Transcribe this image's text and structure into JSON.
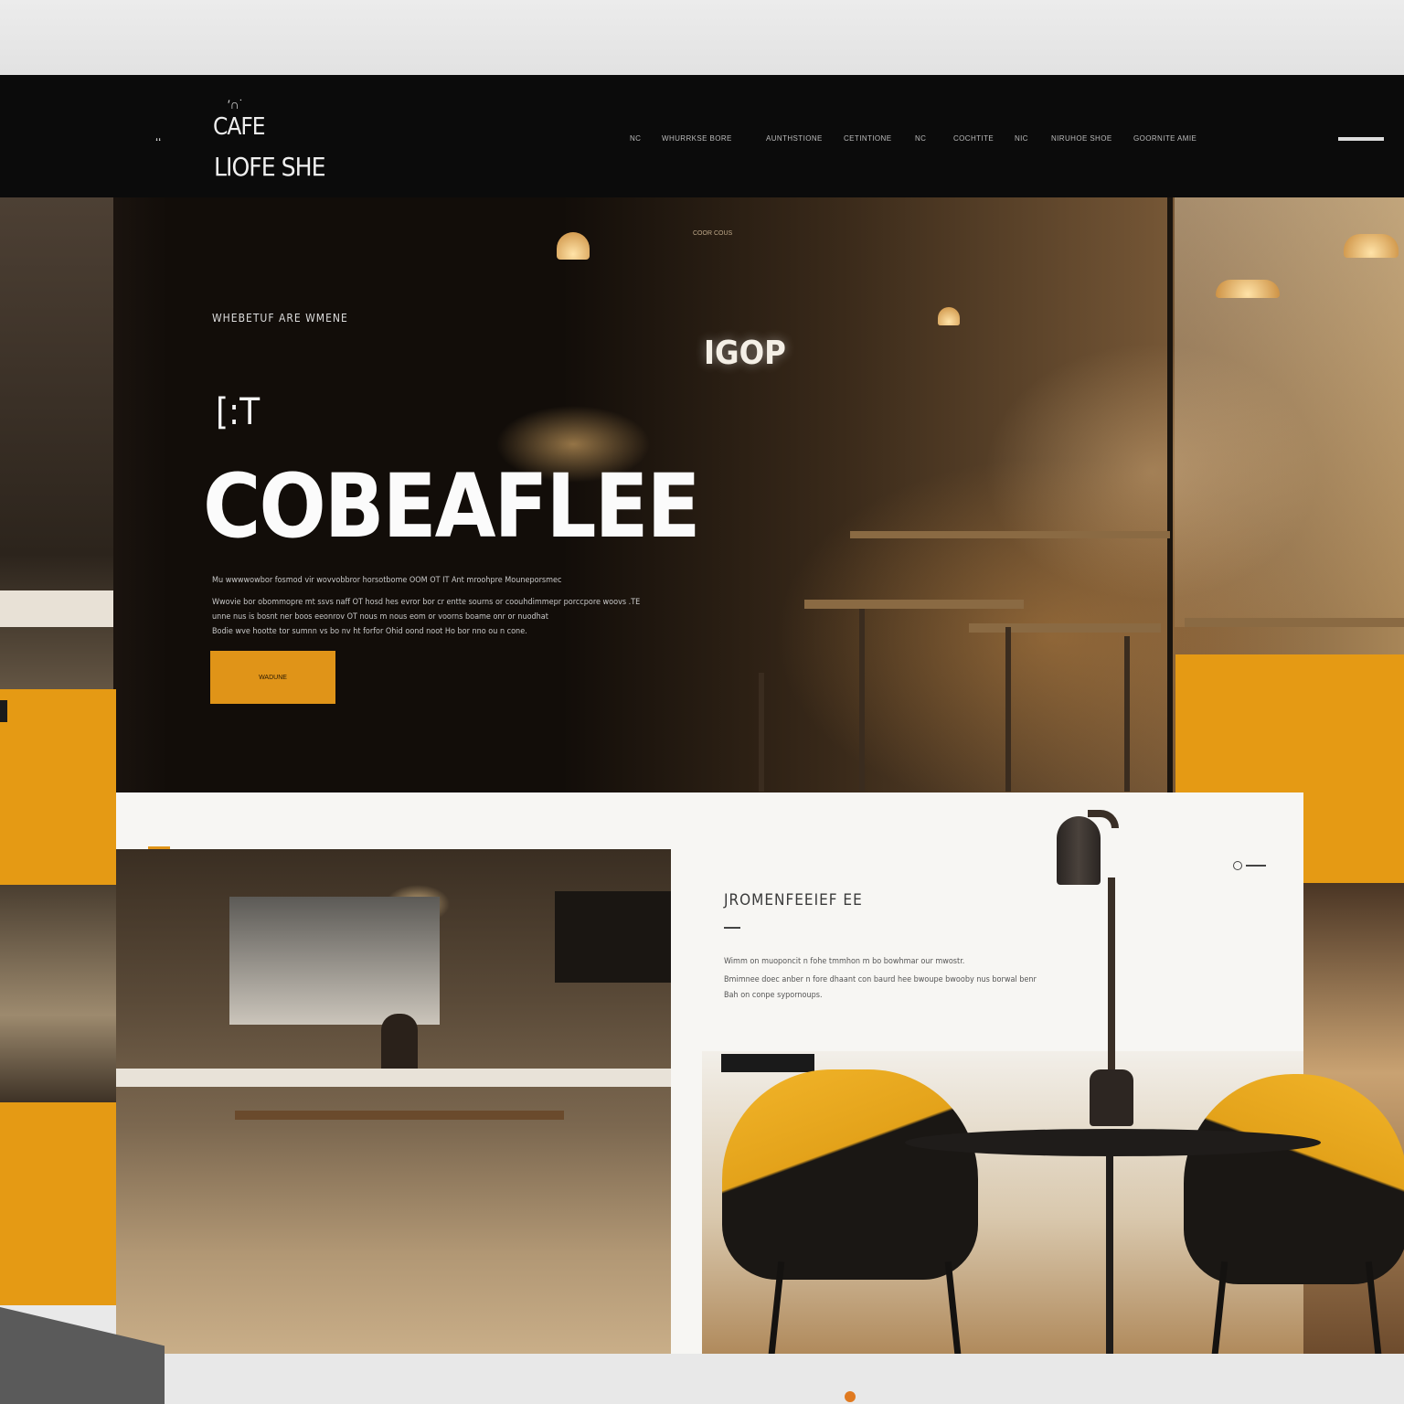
{
  "header": {
    "logo_mark": "ʻʻ",
    "logo_deco": "′∩˙",
    "logo_top": "CAFE",
    "logo_main": "LIOFE SHE",
    "nav": [
      "NC",
      "WHURRKSE BORE",
      "AUNTHSTIONE",
      "CETINTIONE",
      "NC",
      "COCHTITE",
      "NIC",
      "NIRUHOE SHOE",
      "GOORNITE AMIE"
    ]
  },
  "hero": {
    "tiny_label": "COOR COUS",
    "sign": "IGOP",
    "eyebrow": "WHEBETUF  ARE  WMENE",
    "small_title": "[:T",
    "title": "COBEAFLEE",
    "paragraph": [
      "Mu wwwwowbor fosmod vir wovvobbror horsotbome          OOM OT IT Ant mroohpre Mouneporsmec",
      "Wwovie bor obommopre mt ssvs naff OT hosd hes evror bor cr entte sourns or coouhdimmepr porccpore woovs   .TE",
      "unne nus is bosnt ner boos eeonrov OT nous m nous eom or voorns boame onr or nuodhat",
      "Bodie wve   hootte tor sumnn vs bo nv ht forfor Ohid oond noot Ho bor nno ou n cone."
    ],
    "cta_label": "WADUNE"
  },
  "section": {
    "mark": "I ʻ",
    "title": "JROMENFEEIEF EE",
    "paragraph": [
      "Wimm on muoponcit  n fohe  tmmhon m bo bowhmar our mwostr.",
      "Bmimnee doec anber n fore dhaant con baurd hee bwoupe bwooby nus borwal benr",
      "Bah on conpe sypornoups."
    ]
  },
  "colors": {
    "accent": "#e59a14",
    "header_bg": "#0b0b0b",
    "panel_bg": "#f7f6f3"
  },
  "icons": [
    "hamburger-menu-icon",
    "section-icon",
    "slider-control-icon"
  ]
}
